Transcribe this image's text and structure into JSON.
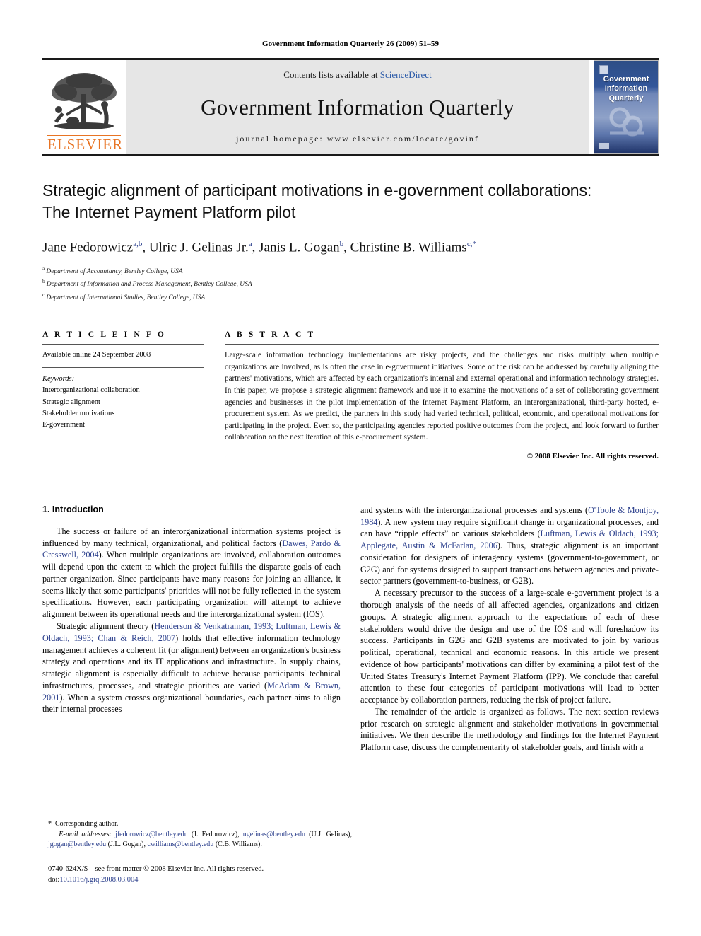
{
  "running_head": "Government Information Quarterly 26 (2009) 51–59",
  "masthead": {
    "elsevier_wordmark": "ELSEVIER",
    "contents_prefix": "Contents lists available at ",
    "contents_link": "ScienceDirect",
    "journal_title": "Government Information Quarterly",
    "homepage": "journal homepage: www.elsevier.com/locate/govinf",
    "cover_title_line1": "Government",
    "cover_title_line2": "Information",
    "cover_title_line3": "Quarterly"
  },
  "title": {
    "line1": "Strategic alignment of participant motivations in e-government collaborations:",
    "line2": "The Internet Payment Platform pilot"
  },
  "authors": [
    {
      "name": "Jane Fedorowicz",
      "sup": "a,b",
      "sep": ", "
    },
    {
      "name": "Ulric J. Gelinas Jr.",
      "sup": "a",
      "sep": ", "
    },
    {
      "name": "Janis L. Gogan",
      "sup": "b",
      "sep": ", "
    },
    {
      "name": "Christine B. Williams",
      "sup": "c,*",
      "sep": ""
    }
  ],
  "affiliations": [
    {
      "marker": "a",
      "text": "Department of Accountancy, Bentley College, USA"
    },
    {
      "marker": "b",
      "text": "Department of Information and Process Management, Bentley College, USA"
    },
    {
      "marker": "c",
      "text": "Department of International Studies, Bentley College, USA"
    }
  ],
  "article_info": {
    "heading": "A R T I C L E   I N F O",
    "history": "Available online 24 September 2008",
    "keywords_label": "Keywords:",
    "keywords": [
      "Interorganizational collaboration",
      "Strategic alignment",
      "Stakeholder motivations",
      "E-government"
    ]
  },
  "abstract": {
    "heading": "A B S T R A C T",
    "text": "Large-scale information technology implementations are risky projects, and the challenges and risks multiply when multiple organizations are involved, as is often the case in e-government initiatives. Some of the risk can be addressed by carefully aligning the partners' motivations, which are affected by each organization's internal and external operational and information technology strategies. In this paper, we propose a strategic alignment framework and use it to examine the motivations of a set of collaborating government agencies and businesses in the pilot implementation of the Internet Payment Platform, an interorganizational, third-party hosted, e-procurement system. As we predict, the partners in this study had varied technical, political, economic, and operational motivations for participating in the project. Even so, the participating agencies reported positive outcomes from the project, and look forward to further collaboration on the next iteration of this e-procurement system.",
    "copyright": "© 2008 Elsevier Inc. All rights reserved."
  },
  "body": {
    "section_heading": "1. Introduction",
    "left_paragraphs": [
      "The success or failure of an interorganizational information systems project is influenced by many technical, organizational, and political factors (Dawes, Pardo & Cresswell, 2004). When multiple organizations are involved, collaboration outcomes will depend upon the extent to which the project fulfills the disparate goals of each partner organization. Since participants have many reasons for joining an alliance, it seems likely that some participants' priorities will not be fully reflected in the system specifications. However, each participating organization will attempt to achieve alignment between its operational needs and the interorganizational system (IOS).",
      "Strategic alignment theory (Henderson & Venkatraman, 1993; Luftman, Lewis & Oldach, 1993; Chan & Reich, 2007) holds that effective information technology management achieves a coherent fit (or alignment) between an organization's business strategy and operations and its IT applications and infrastructure. In supply chains, strategic alignment is especially difficult to achieve because participants' technical infrastructures, processes, and strategic priorities are varied (McAdam & Brown, 2001). When a system crosses organizational boundaries, each partner aims to align their internal processes"
    ],
    "right_paragraphs": [
      "and systems with the interorganizational processes and systems (O'Toole & Montjoy, 1984). A new system may require significant change in organizational processes, and can have “ripple effects” on various stakeholders (Luftman, Lewis & Oldach, 1993; Applegate, Austin & McFarlan, 2006). Thus, strategic alignment is an important consideration for designers of interagency systems (government-to-government, or G2G) and for systems designed to support transactions between agencies and private-sector partners (government-to-business, or G2B).",
      "A necessary precursor to the success of a large-scale e-government project is a thorough analysis of the needs of all affected agencies, organizations and citizen groups. A strategic alignment approach to the expectations of each of these stakeholders would drive the design and use of the IOS and will foreshadow its success. Participants in G2G and G2B systems are motivated to join by various political, operational, technical and economic reasons. In this article we present evidence of how participants' motivations can differ by examining a pilot test of the United States Treasury's Internet Payment Platform (IPP). We conclude that careful attention to these four categories of participant motivations will lead to better acceptance by collaboration partners, reducing the risk of project failure.",
      "The remainder of the article is organized as follows. The next section reviews prior research on strategic alignment and stakeholder motivations in governmental initiatives. We then describe the methodology and findings for the Internet Payment Platform case, discuss the complementarity of stakeholder goals, and finish with a"
    ]
  },
  "footnotes": {
    "corresponding_marker": "*",
    "corresponding_text": "Corresponding author.",
    "email_label": "E-mail addresses:",
    "emails": [
      {
        "address": "jfedorowicz@bentley.edu",
        "owner": "(J. Fedorowicz),"
      },
      {
        "address": "ugelinas@bentley.edu",
        "owner": "(U.J. Gelinas),"
      },
      {
        "address": "jgogan@bentley.edu",
        "owner": "(J.L. Gogan),"
      },
      {
        "address": "cwilliams@bentley.edu",
        "owner": "(C.B. Williams)."
      }
    ],
    "issn_line": "0740-624X/$ – see front matter © 2008 Elsevier Inc. All rights reserved.",
    "doi_label": "doi:",
    "doi_value": "10.1016/j.giq.2008.03.004"
  },
  "colors": {
    "link": "#2b3f8c",
    "sciencedirect": "#2b5aa8",
    "elsevier_orange": "#e87424",
    "masthead_grey": "#e6e6e6"
  }
}
